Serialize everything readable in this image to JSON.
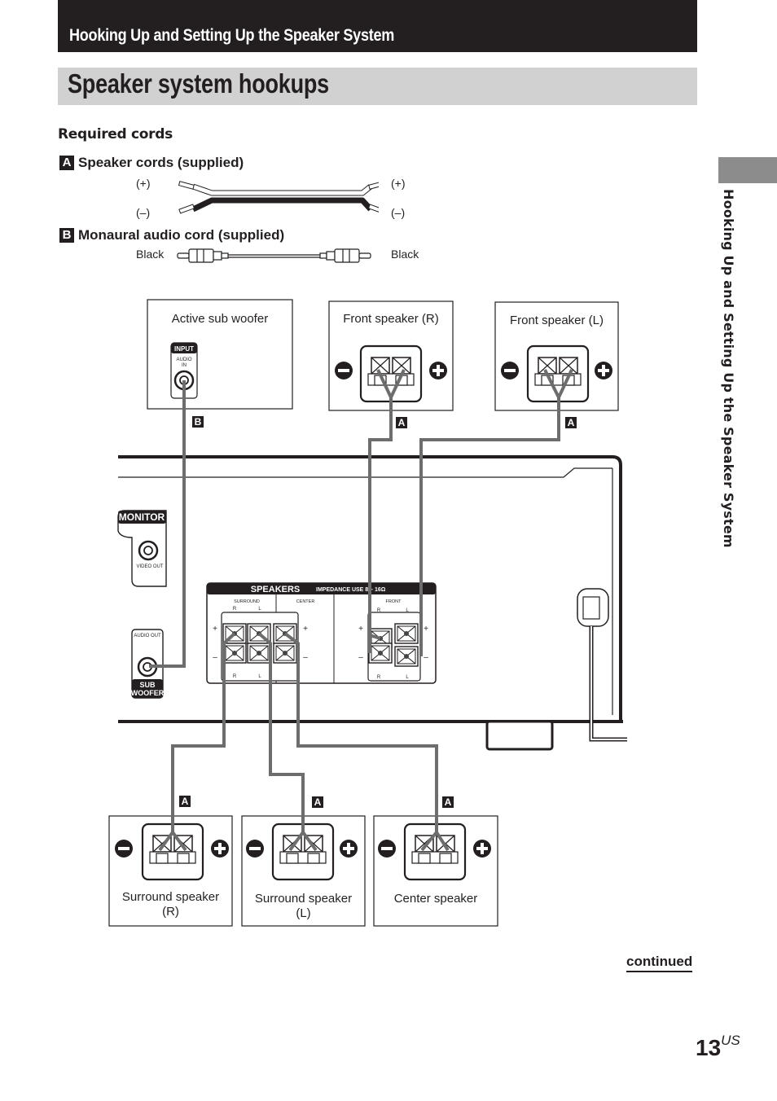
{
  "header": {
    "section_title": "Hooking Up and Setting Up the Speaker System",
    "page_title": "Speaker system hookups"
  },
  "side_tab": {
    "text": "Hooking Up and Setting Up the Speaker System"
  },
  "required_cords": {
    "heading": "Required cords",
    "cords": [
      {
        "badge": "A",
        "label": "Speaker cords (supplied)",
        "left_top": "(+)",
        "left_bottom": "(–)",
        "right_top": "(+)",
        "right_bottom": "(–)"
      },
      {
        "badge": "B",
        "label": "Monaural audio cord (supplied)",
        "left": "Black",
        "right": "Black"
      }
    ]
  },
  "diagram": {
    "subwoofer": {
      "label": "Active sub woofer",
      "panel_title": "INPUT",
      "jack_label_1": "AUDIO",
      "jack_label_2": "IN",
      "cord": "B"
    },
    "front_right": {
      "label": "Front speaker (R)",
      "cord": "A"
    },
    "front_left": {
      "label": "Front speaker (L)",
      "cord": "A"
    },
    "receiver": {
      "monitor_title": "MONITOR",
      "video_out": "VIDEO OUT",
      "audio_out": "AUDIO OUT",
      "sub_label_1": "SUB",
      "sub_label_2": "WOOFER",
      "speakers_title": "SPEAKERS",
      "impedance": "IMPEDANCE USE 8 – 16Ω",
      "surround": "SURROUND",
      "center": "CENTER",
      "front": "FRONT",
      "r": "R",
      "l": "L",
      "plus": "+",
      "minus": "–"
    },
    "surround_right": {
      "label_1": "Surround speaker",
      "label_2": "(R)",
      "cord": "A"
    },
    "surround_left": {
      "label_1": "Surround speaker",
      "label_2": "(L)",
      "cord": "A"
    },
    "center_speaker": {
      "label": "Center speaker",
      "cord": "A"
    }
  },
  "footer": {
    "continued": "continued",
    "page_number": "13",
    "page_suffix": "US"
  },
  "colors": {
    "dark": "#231f20",
    "title_bar": "#d1d1d1",
    "side_tab": "#8c8c8c",
    "wire": "#6d6d6d"
  }
}
